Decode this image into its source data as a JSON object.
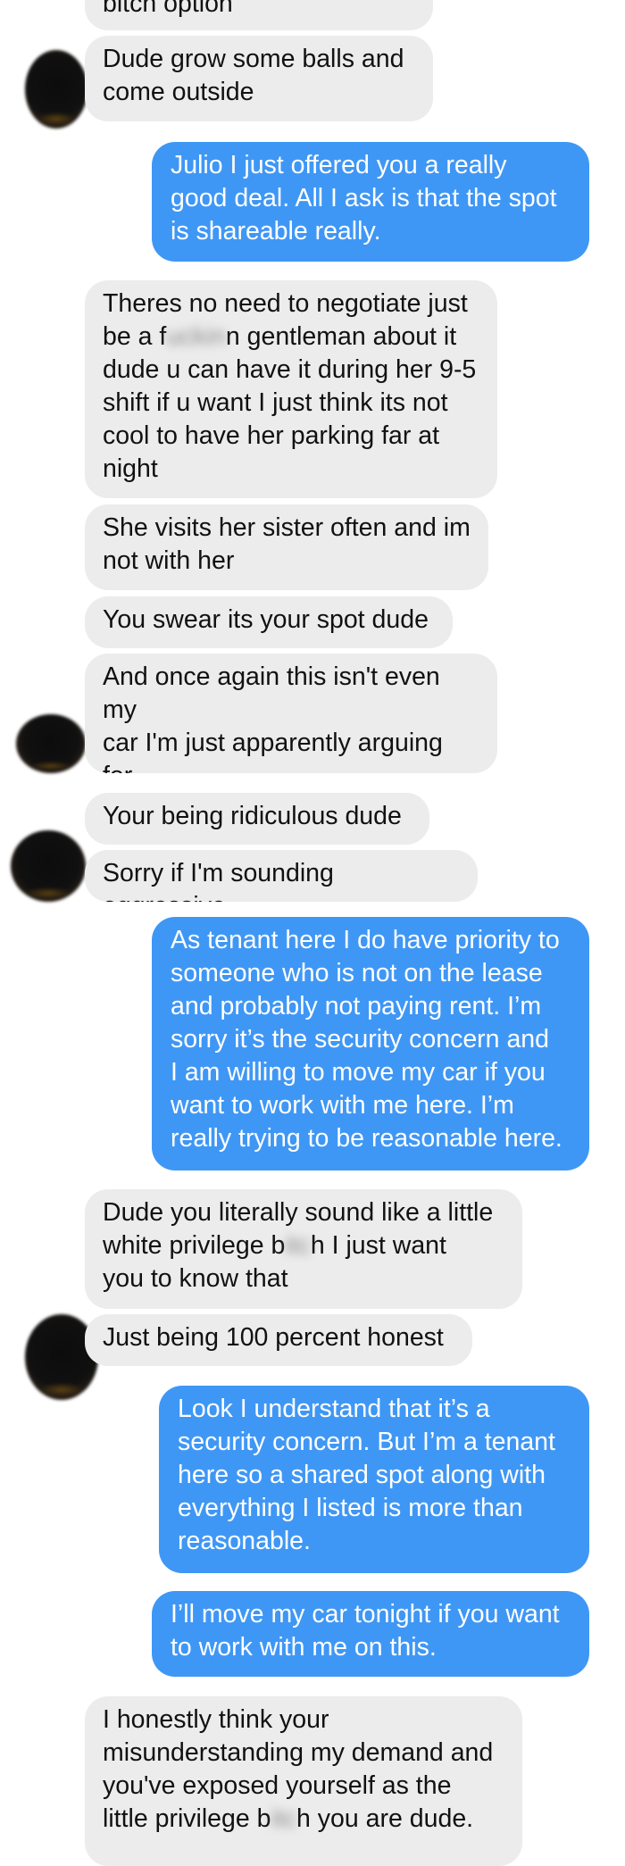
{
  "conversation": {
    "messages": [
      {
        "dir": "in",
        "text": "bitch option"
      },
      {
        "dir": "in",
        "text": "Dude grow some balls and\ncome outside"
      },
      {
        "dir": "out",
        "text": "Julio I just offered you a really\ngood deal. All I ask is that the spot\nis shareable really."
      },
      {
        "dir": "in",
        "text_a": "Theres no need to negotiate just\nbe a f",
        "censored": "uckin",
        "text_b": "n gentleman about it\ndude u can have it during her 9-5\nshift if u want I just think its not\ncool to have her parking far at\nnight"
      },
      {
        "dir": "in",
        "text": "She visits her sister often and im\nnot with her"
      },
      {
        "dir": "in",
        "text": "You swear its your spot dude"
      },
      {
        "dir": "in",
        "text": "And once again this isn't even my\ncar I'm just apparently arguing for\nyou to do the right things"
      },
      {
        "dir": "in",
        "text": "Your being ridiculous dude"
      },
      {
        "dir": "in",
        "text": "Sorry if I'm sounding aggressive"
      },
      {
        "dir": "out",
        "text": "As tenant here I do have priority to\nsomeone who is not on the lease\nand probably not paying rent. I’m\nsorry it’s the security concern and\nI am willing to move my car if you\nwant to work with me here. I’m\nreally trying to be reasonable here."
      },
      {
        "dir": "in",
        "text_a": "Dude you literally sound like a little\nwhite privilege b",
        "censored": "itc",
        "text_b": "h I just want\nyou to know that"
      },
      {
        "dir": "in",
        "text": "Just being 100 percent honest"
      },
      {
        "dir": "out",
        "text": "Look I understand that it’s a\nsecurity concern. But I’m a tenant\nhere so a shared spot along with\neverything I listed is more than\nreasonable."
      },
      {
        "dir": "out",
        "text": "I’ll move my car tonight if you want\nto work with me on this."
      },
      {
        "dir": "in",
        "text_a": "I honestly think your\nmisunderstanding my demand and\nyou've exposed yourself as the\nlittle privilege b",
        "censored": "itc",
        "text_b": "h you are dude."
      }
    ]
  },
  "colors": {
    "incoming_bubble": "#ececec",
    "outgoing_bubble": "#3f97f5",
    "incoming_text": "#111111",
    "outgoing_text": "#ffffff"
  }
}
